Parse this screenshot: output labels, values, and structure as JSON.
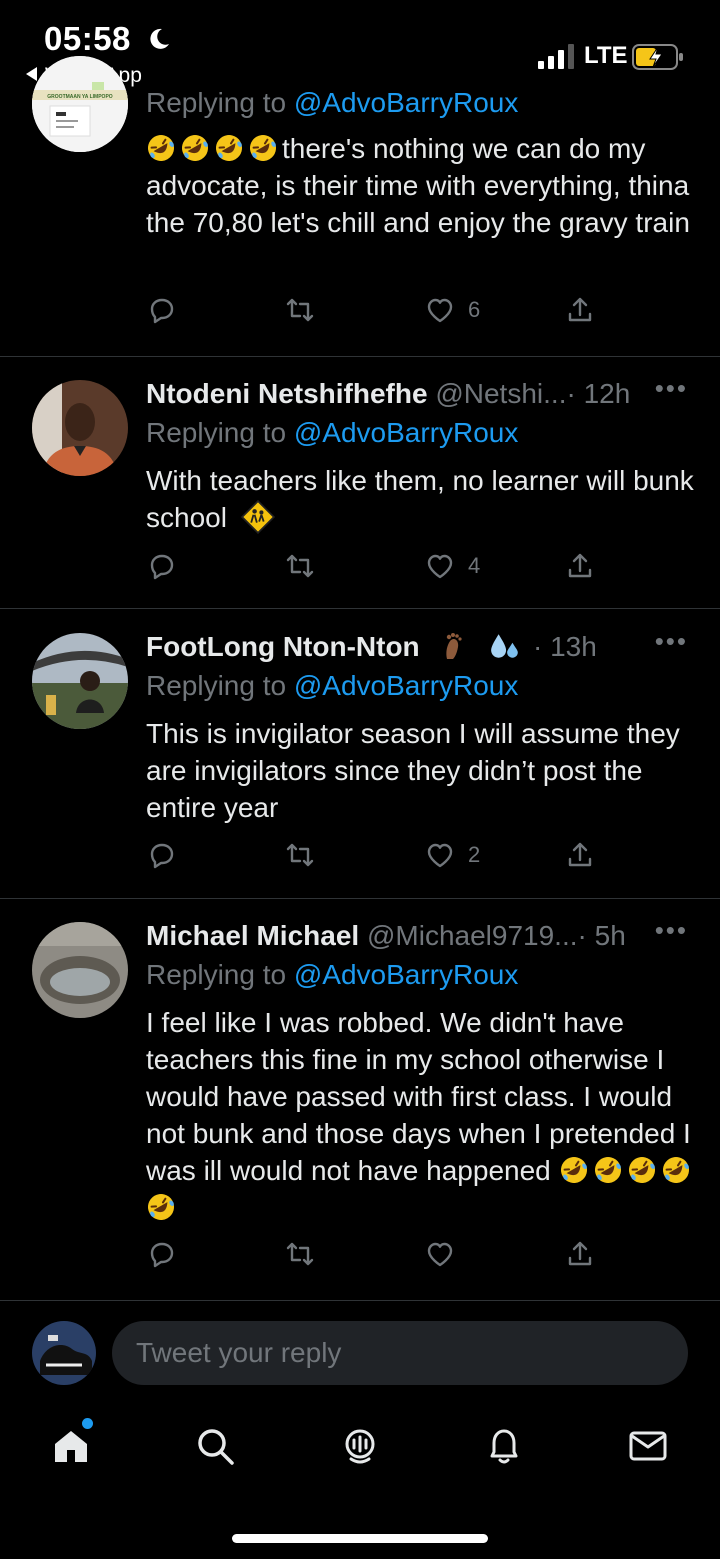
{
  "status_bar": {
    "time": "05:58",
    "back_app": "WhatsApp",
    "network": "LTE"
  },
  "tweets": [
    {
      "name": "",
      "handle": "",
      "time": "",
      "replying_prefix": "Replying to ",
      "replying_to": "@AdvoBarryRoux",
      "text": "there's nothing we can do my advocate, is their time with everything, thina the 70,80 let's chill and enjoy the gravy train",
      "leading_emoji": [
        "rofl",
        "rofl",
        "rofl",
        "rofl"
      ],
      "trailing_emoji": [],
      "likes": "6",
      "avatar_caption": "GROOTMAAN YA LIMPOPO"
    },
    {
      "name": "Ntodeni Netshifhefhe",
      "handle": "@Netshi...",
      "time": "· 12h",
      "replying_prefix": "Replying to ",
      "replying_to": "@AdvoBarryRoux",
      "text": "With teachers like them, no learner will bunk school",
      "leading_emoji": [],
      "trailing_emoji": [
        "school-crossing"
      ],
      "likes": "4"
    },
    {
      "name": "FootLong Nton-Nton",
      "name_emoji": [
        "foot",
        "sweat-droplets"
      ],
      "handle": "",
      "time": "· 13h",
      "replying_prefix": "Replying to ",
      "replying_to": "@AdvoBarryRoux",
      "text": "This is invigilator season I will assume they are invigilators since they didn’t post the entire year",
      "leading_emoji": [],
      "trailing_emoji": [],
      "likes": "2"
    },
    {
      "name": "Michael Michael",
      "handle": "@Michael9719...",
      "time": "· 5h",
      "replying_prefix": "Replying to ",
      "replying_to": "@AdvoBarryRoux",
      "text": "I feel like I was robbed.  We didn't have teachers this fine in my school otherwise I would have passed with first class.  I would not bunk and those days when I pretended I was ill would not have happened",
      "leading_emoji": [],
      "trailing_emoji": [
        "rofl",
        "rofl",
        "rofl",
        "rofl",
        "rofl"
      ],
      "likes": ""
    }
  ],
  "more_label": "•••",
  "reply_bar": {
    "placeholder": "Tweet your reply"
  },
  "tabs": [
    "home-icon",
    "search-icon",
    "spaces-icon",
    "notifications-icon",
    "messages-icon"
  ],
  "colors": {
    "accent": "#1d9bf0",
    "muted": "#71767b",
    "divider": "#2f3336",
    "bg": "#000000"
  }
}
